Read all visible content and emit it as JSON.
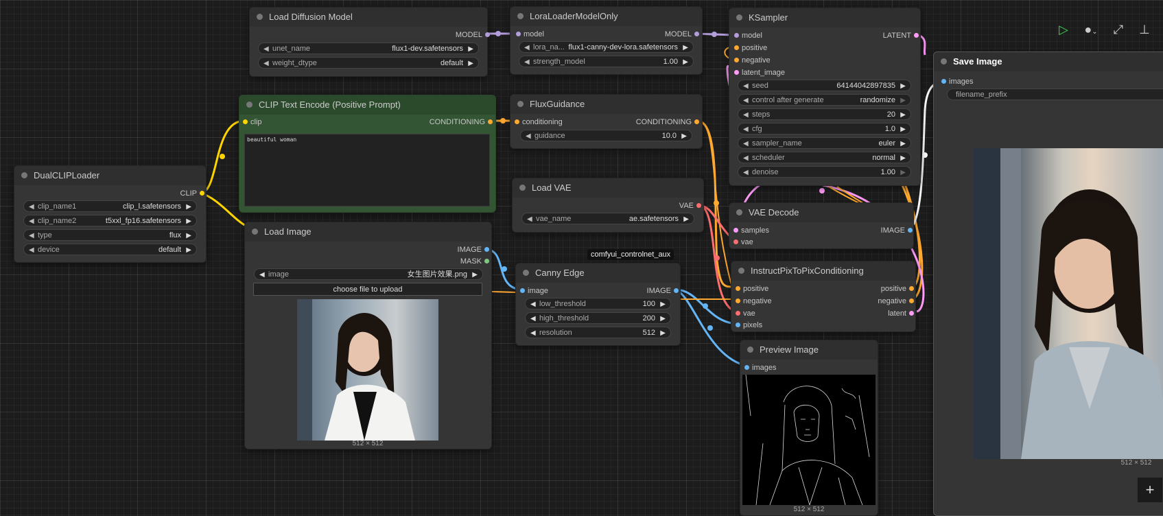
{
  "nodes": {
    "load_diffusion": {
      "title": "Load Diffusion Model",
      "out_model": "MODEL",
      "unet_name_label": "unet_name",
      "unet_name_value": "flux1-dev.safetensors",
      "weight_dtype_label": "weight_dtype",
      "weight_dtype_value": "default"
    },
    "lora": {
      "title": "LoraLoaderModelOnly",
      "in_model": "model",
      "out_model": "MODEL",
      "lora_label": "lora_na...",
      "lora_value": "flux1-canny-dev-lora.safetensors",
      "strength_label": "strength_model",
      "strength_value": "1.00"
    },
    "ksampler": {
      "title": "KSampler",
      "in_model": "model",
      "in_positive": "positive",
      "in_negative": "negative",
      "in_latent": "latent_image",
      "out_latent": "LATENT",
      "widgets": [
        {
          "label": "seed",
          "value": "641440428978​35"
        },
        {
          "label": "control after generate",
          "value": "randomize"
        },
        {
          "label": "steps",
          "value": "20"
        },
        {
          "label": "cfg",
          "value": "1.0"
        },
        {
          "label": "sampler_name",
          "value": "euler"
        },
        {
          "label": "scheduler",
          "value": "normal"
        },
        {
          "label": "denoise",
          "value": "1.00"
        }
      ]
    },
    "save_image": {
      "title": "Save Image",
      "in_images": "images",
      "filename_label": "filename_prefix",
      "dims": "512 × 512"
    },
    "clip_text": {
      "title": "CLIP Text Encode (Positive Prompt)",
      "in_clip": "clip",
      "out_cond": "CONDITIONING",
      "text": "beautiful woman"
    },
    "flux_guidance": {
      "title": "FluxGuidance",
      "in_cond": "conditioning",
      "out_cond": "CONDITIONING",
      "guidance_label": "guidance",
      "guidance_value": "10.0"
    },
    "dual_clip": {
      "title": "DualCLIPLoader",
      "out_clip": "CLIP",
      "widgets": [
        {
          "label": "clip_name1",
          "value": "clip_l.safetensors"
        },
        {
          "label": "clip_name2",
          "value": "t5xxl_fp16.safetensors"
        },
        {
          "label": "type",
          "value": "flux"
        },
        {
          "label": "device",
          "value": "default"
        }
      ]
    },
    "load_vae": {
      "title": "Load VAE",
      "out_vae": "VAE",
      "vae_label": "vae_name",
      "vae_value": "ae.safetensors"
    },
    "vae_decode": {
      "title": "VAE Decode",
      "in_samples": "samples",
      "in_vae": "vae",
      "out_image": "IMAGE"
    },
    "load_image": {
      "title": "Load Image",
      "out_image": "IMAGE",
      "out_mask": "MASK",
      "image_label": "image",
      "image_value": "女生图片效果.png",
      "upload_label": "choose file to upload",
      "dims": "512 × 512"
    },
    "canny": {
      "title": "Canny Edge",
      "badge": "comfyui_controlnet_aux",
      "in_image": "image",
      "out_image": "IMAGE",
      "widgets": [
        {
          "label": "low_threshold",
          "value": "100"
        },
        {
          "label": "high_threshold",
          "value": "200"
        },
        {
          "label": "resolution",
          "value": "512"
        }
      ]
    },
    "instruct": {
      "title": "InstructPixToPixConditioning",
      "in_positive": "positive",
      "in_negative": "negative",
      "in_vae": "vae",
      "in_pixels": "pixels",
      "out_positive": "positive",
      "out_negative": "negative",
      "out_latent": "latent"
    },
    "preview": {
      "title": "Preview Image",
      "in_images": "images",
      "dims": "512 × 512"
    }
  },
  "colors": {
    "model": "#b39ddb",
    "clip": "#ffd500",
    "conditioning": "#ffa931",
    "latent": "#ff9cf9",
    "vae": "#ff6e6e",
    "image": "#64b5f6",
    "mask": "#81c784",
    "run": "#39d353"
  },
  "toolbar": {
    "run_icon": "play-icon",
    "queue_icon": "circle-dropdown-icon",
    "link_icon": "link-toggle-icon",
    "pin_icon": "pin-icon",
    "add_icon": "plus-icon"
  }
}
